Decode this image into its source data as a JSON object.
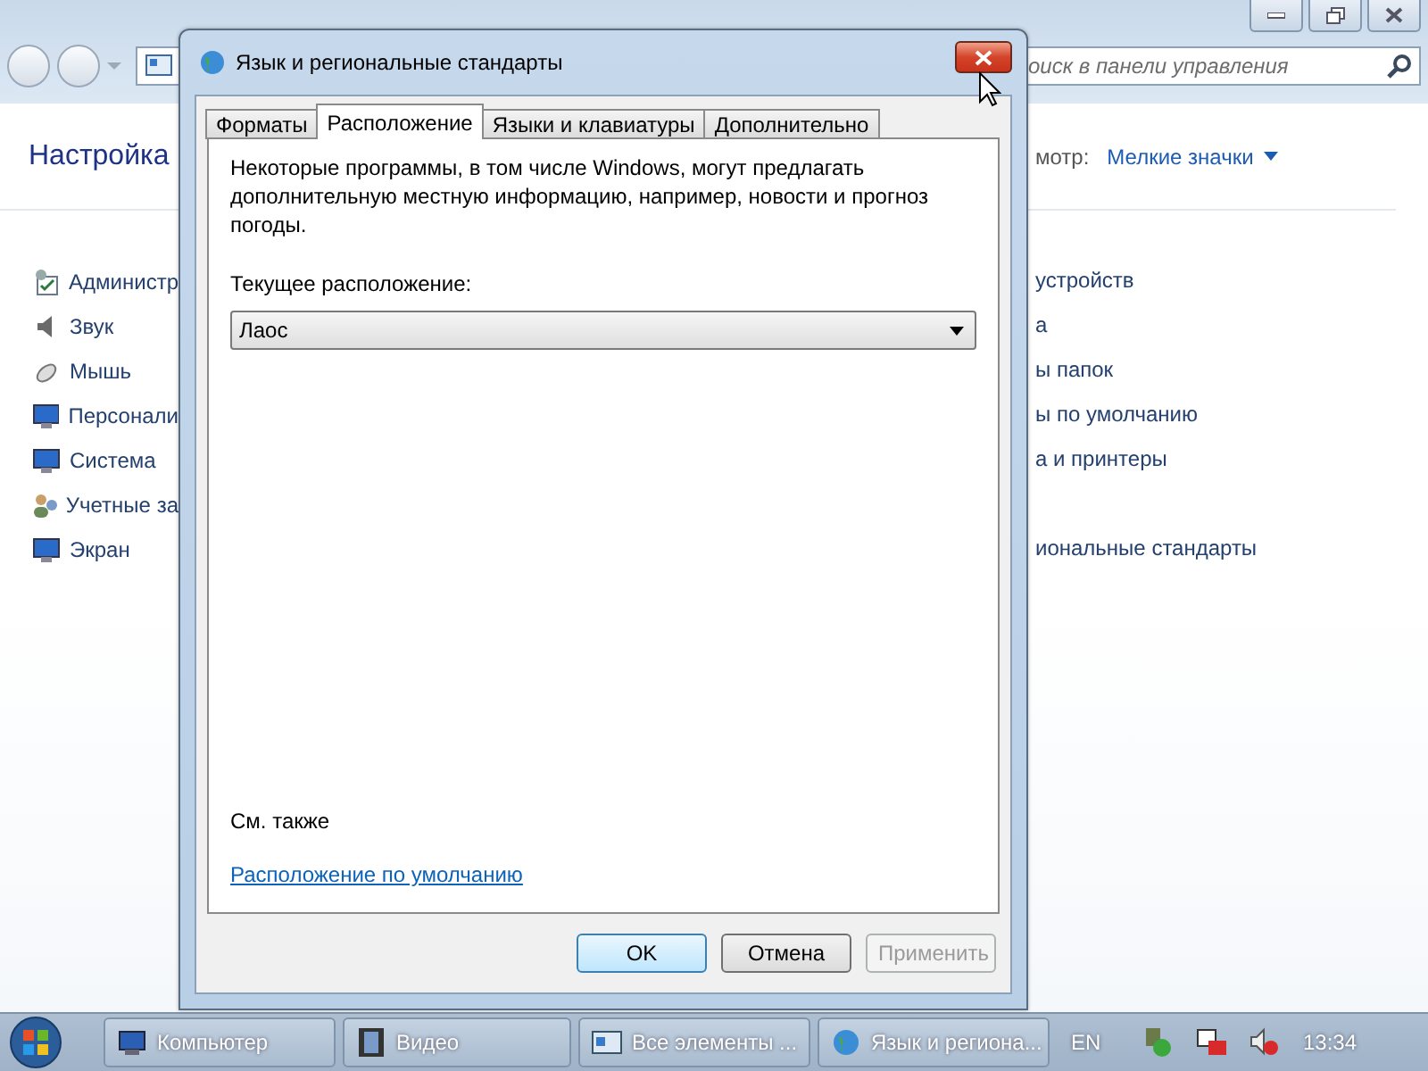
{
  "search": {
    "placeholder": "оиск в панели управления"
  },
  "header": {
    "title": "Настройка",
    "view_label": "мотр:",
    "view_value": "Мелкие значки"
  },
  "left_items": [
    {
      "label": "Администр",
      "kind": "admin"
    },
    {
      "label": "Звук",
      "kind": "sound"
    },
    {
      "label": "Мышь",
      "kind": "mouse"
    },
    {
      "label": "Персонали",
      "kind": "monitor"
    },
    {
      "label": "Система",
      "kind": "monitor"
    },
    {
      "label": "Учетные за",
      "kind": "users"
    },
    {
      "label": "Экран",
      "kind": "monitor"
    }
  ],
  "right_items": [
    "устройств",
    "а",
    "ы папок",
    "ы по умолчанию",
    "а и принтеры",
    "иональные стандарты"
  ],
  "dialog": {
    "title": "Язык и региональные стандарты",
    "tabs": [
      {
        "label": "Форматы",
        "selected": false
      },
      {
        "label": "Расположение",
        "selected": true
      },
      {
        "label": "Языки и клавиатуры",
        "selected": false
      },
      {
        "label": "Дополнительно",
        "selected": false
      }
    ],
    "description": "Некоторые программы, в том числе Windows, могут предлагать дополнительную местную информацию, например, новости и прогноз погоды.",
    "location_label": "Текущее расположение:",
    "location_value": "Лаос",
    "see_also": "См. также",
    "link": "Расположение по умолчанию",
    "buttons": [
      {
        "label": "OK",
        "default": true,
        "disabled": false
      },
      {
        "label": "Отмена",
        "default": false,
        "disabled": false
      },
      {
        "label": "Применить",
        "default": false,
        "disabled": true
      }
    ]
  },
  "taskbar": {
    "buttons": [
      {
        "label": "Компьютер",
        "kind": "computer"
      },
      {
        "label": "Видео",
        "kind": "video"
      },
      {
        "label": "Все элементы ...",
        "kind": "panel"
      },
      {
        "label": "Язык и региона...",
        "kind": "globe"
      }
    ],
    "language": "EN",
    "clock": "13:34"
  }
}
